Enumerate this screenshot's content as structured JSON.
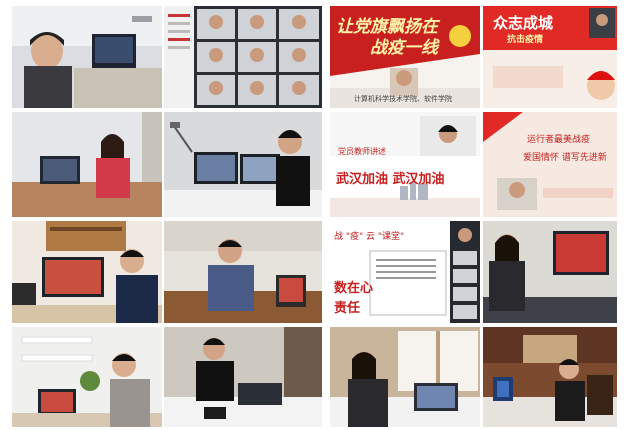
{
  "collage": {
    "poster_1": {
      "title_line1": "让党旗飘扬在",
      "title_line2": "战疫一线",
      "footer": "计算机科学技术学院、软件学院"
    },
    "poster_2": {
      "title": "众志成城",
      "subtitle": "抗击疫情"
    },
    "poster_3": {
      "line1": "党员教师讲述",
      "line2": "武汉加油 武汉加油"
    },
    "poster_4": {
      "line1": "运行者最美战疫",
      "line2": "爱国情怀 谱写先进新"
    },
    "screen_5": {
      "line1": "战 \"疫\" 云 \"课堂\"",
      "line2": "数在心",
      "line3": "责任"
    }
  },
  "colors": {
    "poster_red": "#c8201f",
    "banner_red": "#e12a26",
    "gold": "#f4d03f"
  }
}
